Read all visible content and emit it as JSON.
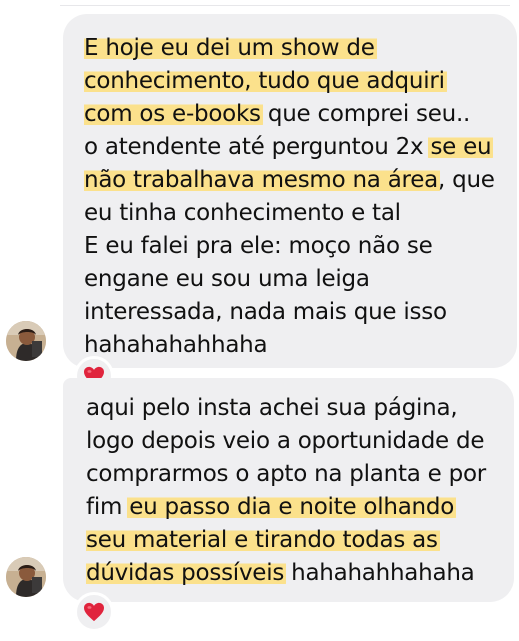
{
  "messages": [
    {
      "paragraphs": [
        {
          "lines": [
            [
              {
                "text": "E hoje eu dei um show de",
                "hl": true
              }
            ],
            [
              {
                "text": "conhecimento, tudo que adquiri",
                "hl": true
              }
            ],
            [
              {
                "text": "com os e-books",
                "hl": true
              },
              {
                "text": " que comprei seu..",
                "hl": false
              }
            ],
            [
              {
                "text": "o atendente até perguntou 2x ",
                "hl": false
              },
              {
                "text": "se eu",
                "hl": true
              }
            ],
            [
              {
                "text": "não trabalhava mesmo na área",
                "hl": true
              },
              {
                "text": ", que",
                "hl": false
              }
            ],
            [
              {
                "text": "eu tinha conhecimento e tal",
                "hl": false
              }
            ]
          ]
        },
        {
          "lines": [
            [
              {
                "text": "E eu falei pra ele: moço não se",
                "hl": false
              }
            ],
            [
              {
                "text": "engane eu sou uma leiga",
                "hl": false
              }
            ],
            [
              {
                "text": "interessada, nada mais que isso",
                "hl": false
              }
            ],
            [
              {
                "text": "hahahahahhaha",
                "hl": false
              }
            ]
          ]
        }
      ],
      "reaction": "heart-emoji"
    },
    {
      "paragraphs": [
        {
          "lines": [
            [
              {
                "text": "aqui pelo insta achei sua página,",
                "hl": false
              }
            ],
            [
              {
                "text": "logo depois veio a oportunidade de",
                "hl": false
              }
            ],
            [
              {
                "text": "comprarmos o apto na planta e por",
                "hl": false
              }
            ],
            [
              {
                "text": "fim ",
                "hl": false
              },
              {
                "text": "eu passo dia e noite olhando",
                "hl": true
              }
            ],
            [
              {
                "text": "seu material e tirando todas as",
                "hl": true
              }
            ],
            [
              {
                "text": "dúvidas possíveis",
                "hl": true
              },
              {
                "text": " hahahahhahaha",
                "hl": false
              }
            ]
          ]
        }
      ],
      "reaction": "heart-emoji"
    }
  ],
  "colors": {
    "bubble": "#efeff1",
    "highlight": "#fbe18c",
    "heart": "#e0243d"
  }
}
